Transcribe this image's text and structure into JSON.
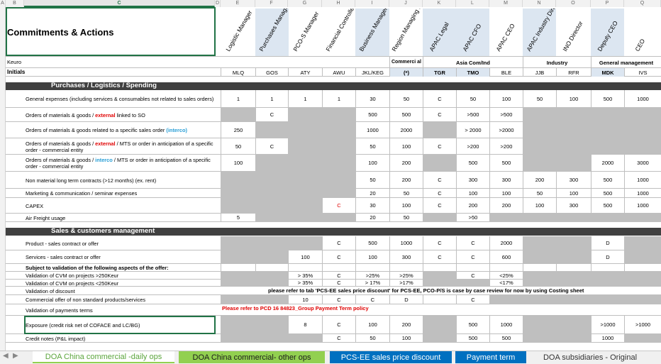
{
  "column_letters": [
    "A",
    "B",
    "C",
    "D",
    "E",
    "F",
    "G",
    "H",
    "I",
    "J",
    "K",
    "L",
    "M",
    "N",
    "O",
    "P",
    "Q"
  ],
  "title": "Commitments & Actions",
  "role_headers": [
    "Logistic Manager",
    "Purchases Manager",
    "PCO-S Manager",
    "Financial Controller",
    "Business Manager",
    "Region Managing Director",
    "APAC Legal",
    "APAC CFO",
    "APAC CEO",
    "APAC Industry Director",
    "INO Director",
    "Deputy CEO",
    "CEO"
  ],
  "row_keuro": {
    "label": "Keuro",
    "commercial": "Commerci al",
    "asia": "Asia Com/Ind",
    "industry": "Industry",
    "general": "General management"
  },
  "row_initials": {
    "label": "Initials",
    "values": [
      "MLQ",
      "GOS",
      "ATY",
      "AWU",
      "JKL/KEG",
      "(*)",
      "TGR",
      "TMO",
      "BLE",
      "JJB",
      "RFR",
      "MDK",
      "IVS"
    ]
  },
  "section_purchases": "Purchases / Logistics / Spending",
  "section_sales": "Sales & customers management",
  "rows": [
    {
      "label": "General expenses (including services & consumables not related to sales orders)",
      "cells": [
        "1",
        "1",
        "1",
        "1",
        "30",
        "50",
        "C",
        "50",
        "100",
        "50",
        "100",
        "500",
        "1000"
      ]
    },
    {
      "label_parts": [
        "Orders of materials & goods / ",
        "external",
        " linked to SO"
      ],
      "cells": [
        "",
        "C",
        "",
        "",
        "500",
        "500",
        "C",
        ">500",
        ">500",
        "",
        "",
        "",
        ""
      ]
    },
    {
      "label_parts": [
        "Orders of materials & goods related to a specific sales order ",
        "(interco)",
        ""
      ],
      "cells": [
        "250",
        "",
        "",
        "",
        "1000",
        "2000",
        "",
        "> 2000",
        ">2000",
        "",
        "",
        "",
        ""
      ]
    },
    {
      "label_parts": [
        "Orders of materials & goods / ",
        "external",
        " / MTS or order in anticipation of a specific order - commercial entity"
      ],
      "cells": [
        "50",
        "C",
        "",
        "",
        "50",
        "100",
        "C",
        ">200",
        ">200",
        "",
        "",
        "",
        ""
      ]
    },
    {
      "label_parts": [
        "Orders of materials & goods / ",
        "interco",
        " / MTS or order in anticipation of a specific order - commercial entity"
      ],
      "cells": [
        "100",
        "",
        "",
        "",
        "100",
        "200",
        "",
        "500",
        "500",
        "",
        "",
        "2000",
        "3000"
      ]
    },
    {
      "label": "Non material long term contracts (>12 months) (ex. rent)",
      "cells": [
        "",
        "",
        "",
        "",
        "50",
        "200",
        "C",
        "300",
        "300",
        "200",
        "300",
        "500",
        "1000"
      ]
    },
    {
      "label": "Marketing & communication / seminar expenses",
      "cells": [
        "",
        "",
        "",
        "",
        "20",
        "50",
        "C",
        "100",
        "100",
        "50",
        "100",
        "500",
        "1000"
      ]
    },
    {
      "label": "CAPEX",
      "cells": [
        "",
        "",
        "",
        "C",
        "30",
        "100",
        "C",
        "200",
        "200",
        "100",
        "300",
        "500",
        "1000"
      ]
    },
    {
      "label": "Air Freight usage",
      "cells": [
        "5",
        "",
        "",
        "",
        "20",
        "50",
        "",
        ">50",
        "",
        "",
        "",
        "",
        ""
      ]
    },
    {
      "label": "Product - sales contract or offer",
      "cells": [
        "",
        "",
        "",
        "C",
        "500",
        "1000",
        "C",
        "C",
        "2000",
        "",
        "",
        "D",
        ""
      ]
    },
    {
      "label": "Services - sales contract or offer",
      "cells": [
        "",
        "",
        "100",
        "C",
        "100",
        "300",
        "C",
        "C",
        "600",
        "",
        "",
        "D",
        ""
      ]
    },
    {
      "label": "Subject to validation of the following aspects of the offer:",
      "cells": [
        "",
        "",
        "",
        "",
        "",
        "",
        "",
        "",
        "",
        "",
        "",
        "",
        ""
      ]
    },
    {
      "label": "Validation of CVM on projects >250Keur",
      "cells": [
        "",
        "",
        "> 35%",
        "C",
        ">25%",
        ">25%",
        "",
        "C",
        "<25%",
        "",
        "",
        "",
        ""
      ]
    },
    {
      "label": "Validation of CVM on projects <250Keur",
      "cells": [
        "",
        "",
        "> 35%",
        "C",
        "> 17%",
        ">17%",
        "",
        "",
        "<17%",
        "",
        "",
        "",
        ""
      ]
    },
    {
      "label": "Validation of discount",
      "note": "please refer to tab 'PCS-EE sales price discount' for PCS-EE, PCO-P/S is case by case review for now by using Costing sheet"
    },
    {
      "label": "Commercial offer of non standard products/services",
      "cells": [
        "",
        "",
        "10",
        "C",
        "C",
        "D",
        "",
        "C",
        "",
        "",
        "",
        "",
        ""
      ]
    },
    {
      "label": "Validation of payments terms",
      "note": "Please refer to PCD 16 84823_Group Payment Term policy"
    },
    {
      "label": "Exposure (credit risk net of COFACE and LC/BG)",
      "cells": [
        "",
        "",
        "8",
        "C",
        "100",
        "200",
        "",
        "500",
        "1000",
        "",
        "",
        ">1000",
        ">1000"
      ]
    },
    {
      "label": "Credit notes (P&L impact)",
      "cells": [
        "",
        "",
        "",
        "C",
        "50",
        "100",
        "",
        "500",
        "500",
        "",
        "",
        "1000",
        ""
      ]
    }
  ],
  "sheet_tabs": [
    "DOA China commercial -daily ops",
    "DOA China commercial- other ops",
    "PCS-EE sales price discount",
    "Payment term",
    "DOA subsidiaries - Original"
  ],
  "colors": {
    "active_tab": "#92d050",
    "blue_tab": "#0070c0",
    "section_bar": "#404040",
    "gray_cell": "#bfbfbf",
    "header_blue": "#dce6f1"
  }
}
